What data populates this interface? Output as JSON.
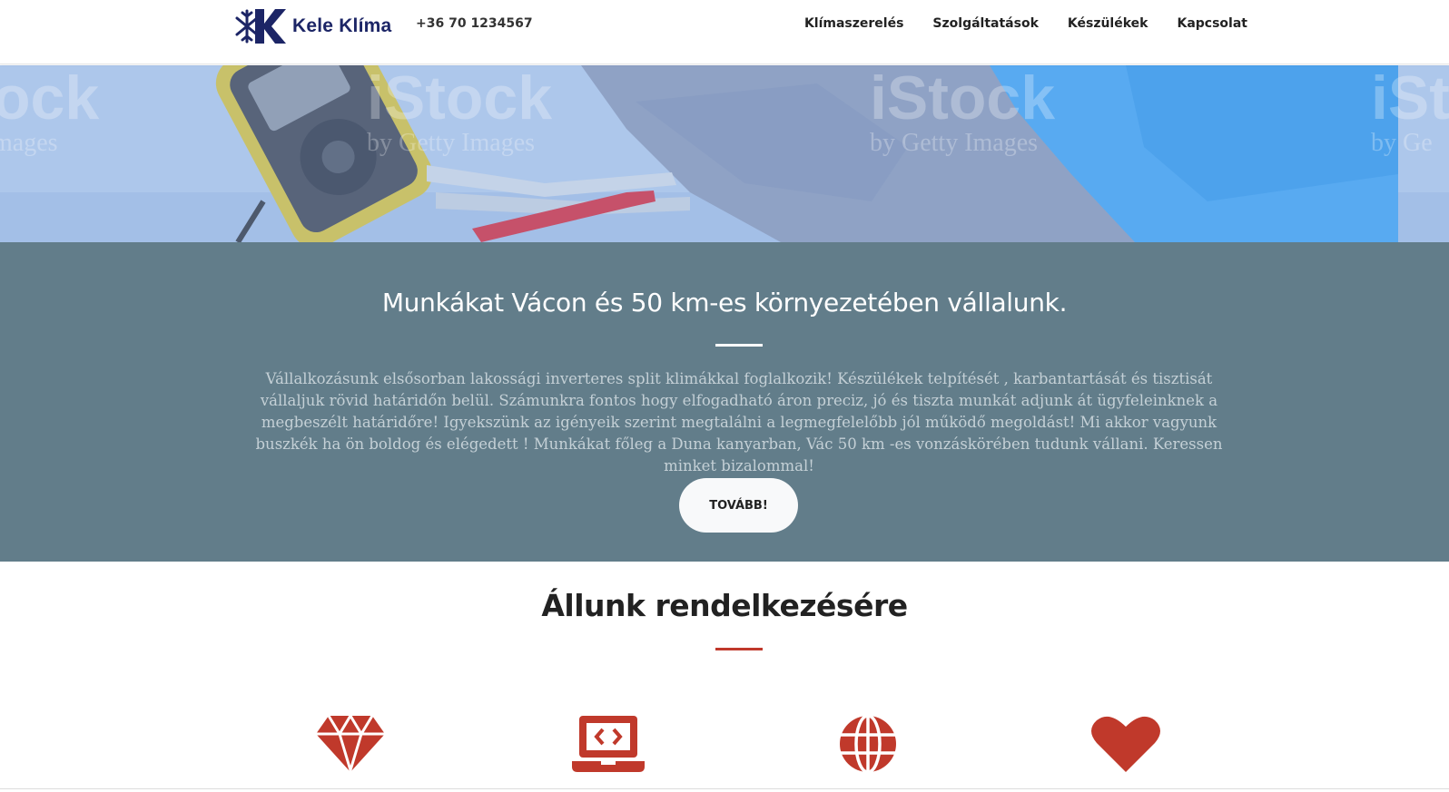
{
  "brand": {
    "name": "Kele Klíma",
    "phone": "+36 70 1234567",
    "color": "#1c2566"
  },
  "nav": {
    "items": [
      {
        "label": "Klímaszerelés"
      },
      {
        "label": "Szolgáltatások"
      },
      {
        "label": "Készülékek"
      },
      {
        "label": "Kapcsolat"
      }
    ]
  },
  "hero": {
    "watermark": {
      "brand": "iStock",
      "sub": "by Getty Images"
    },
    "watermark_left": {
      "brand": "ock",
      "sub": "mages"
    },
    "watermark_right": {
      "brand": "iSt",
      "sub": "by Ge"
    }
  },
  "intro": {
    "title": "Munkákat Vácon és 50 km-es környezetében vállalunk.",
    "text": "Vállalkozásunk elsősorban lakossági inverteres split klimákkal foglalkozik! Készülékek telpítését , karbantartását és tisztisát vállaljuk rövid határidőn belül. Számunkra fontos hogy elfogadható áron preciz, jó és tiszta munkát adjunk át ügyfeleinknek a megbeszélt határidőre! Igyekszünk az igényeik szerint megtalálni a legmegfelelőbb jól működő megoldást! Mi akkor vagyunk buszkék ha ön boldog és elégedett ! Munkákat főleg a Duna kanyarban, Vác 50 km -es vonzáskörében tudunk vállani. Keressen minket bizalommal!",
    "button_label": "TOVÁBB!",
    "background": "#627d8a"
  },
  "services": {
    "title": "Állunk rendelkezésére",
    "accent": "#c0392b",
    "icons": [
      "diamond-icon",
      "laptop-code-icon",
      "globe-icon",
      "heart-icon"
    ]
  }
}
